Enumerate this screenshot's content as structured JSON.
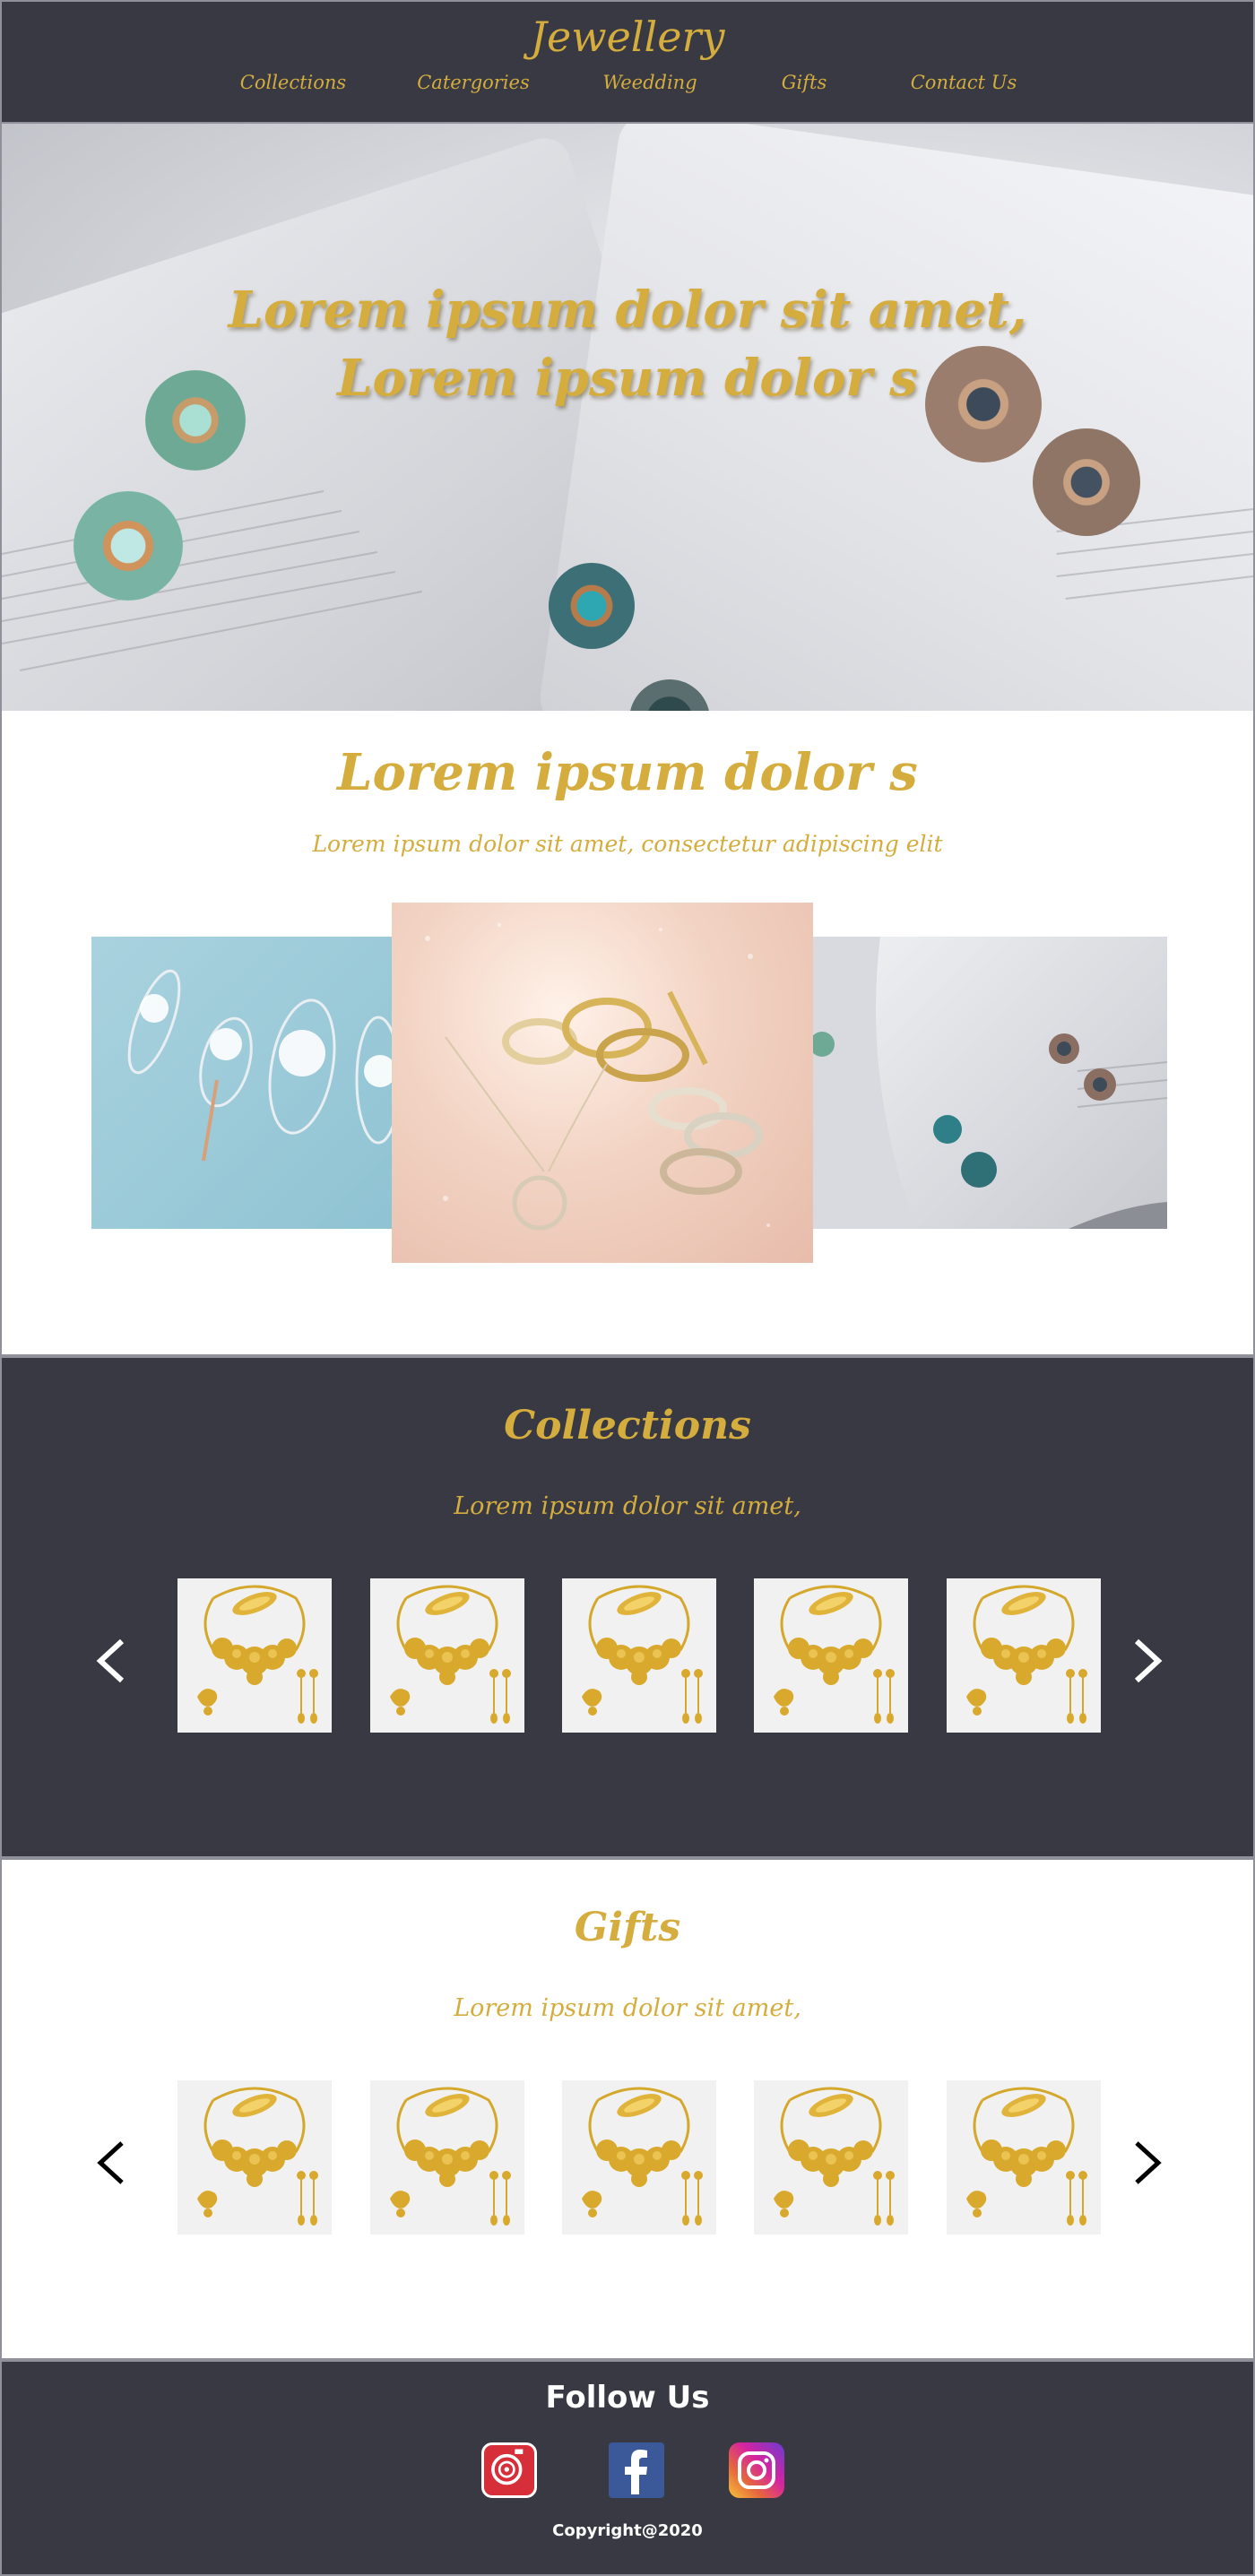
{
  "header": {
    "brand": "Jewellery",
    "nav": [
      "Collections",
      "Catergories",
      "Weedding",
      "Gifts",
      "Contact Us"
    ]
  },
  "hero": {
    "line1": "Lorem ipsum dolor sit amet,",
    "line2": "Lorem ipsum dolor s"
  },
  "intro": {
    "title": "Lorem ipsum dolor s",
    "subtitle": "Lorem ipsum dolor sit amet, consectetur adipiscing elit"
  },
  "collections": {
    "title": "Collections",
    "subtitle": "Lorem ipsum dolor sit amet,",
    "item_count": 5
  },
  "gifts": {
    "title": "Gifts",
    "subtitle": "Lorem ipsum dolor sit amet,",
    "item_count": 5
  },
  "footer": {
    "follow": "Follow Us",
    "copyright": "Copyright@2020",
    "social_icons": [
      "camera-app-icon",
      "facebook-icon",
      "instagram-icon"
    ]
  },
  "colors": {
    "accent": "#d4ad3e",
    "dark": "#383942"
  }
}
